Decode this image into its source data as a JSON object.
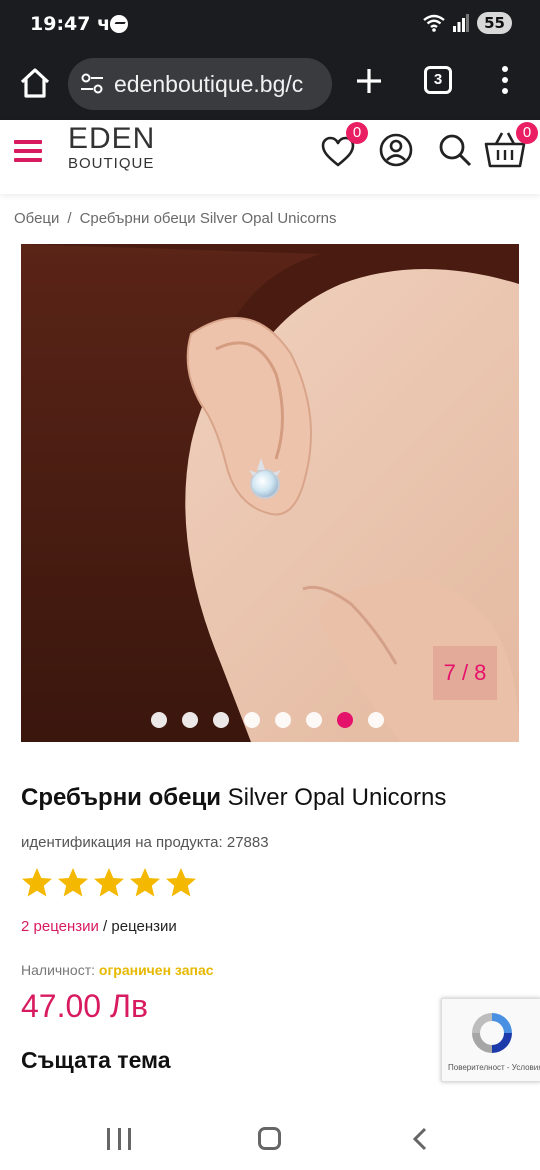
{
  "status": {
    "time": "19:47 ч.",
    "battery": "55"
  },
  "browser": {
    "url": "edenboutique.bg/c",
    "tab_count": "3"
  },
  "site": {
    "logo_line1": "EDEN",
    "logo_line2": "BOUTIQUE",
    "wishlist_count": "0",
    "cart_count": "0",
    "accent_color": "#e91e63"
  },
  "breadcrumb": {
    "category": "Обеци",
    "separator": "/",
    "current": "Сребърни обеци Silver Opal Unicorns"
  },
  "gallery": {
    "counter": "7 / 8",
    "total_images": 8,
    "active_index": 7
  },
  "product": {
    "title_bold": "Сребърни обеци",
    "title_rest": " Silver Opal Unicorns",
    "sku": "идентификация на продукта: 27883",
    "rating": 5,
    "rating_max": 5,
    "reviews_link": "2 рецензии",
    "reviews_suffix": " / рецензии",
    "availability_label": "Наличност:",
    "availability_value": "ограничен запас",
    "price": "47.00 Лв",
    "same_topic_heading": "Същата тема"
  },
  "recaptcha": {
    "terms": "Поверителност - Условия"
  },
  "icons": {
    "home": "home-icon",
    "site_info": "tune-icon",
    "new_tab": "plus-icon",
    "tabs": "tabs-icon",
    "menu": "kebab-icon",
    "wishlist": "heart-icon",
    "account": "user-icon",
    "search": "search-icon",
    "cart": "basket-icon"
  }
}
